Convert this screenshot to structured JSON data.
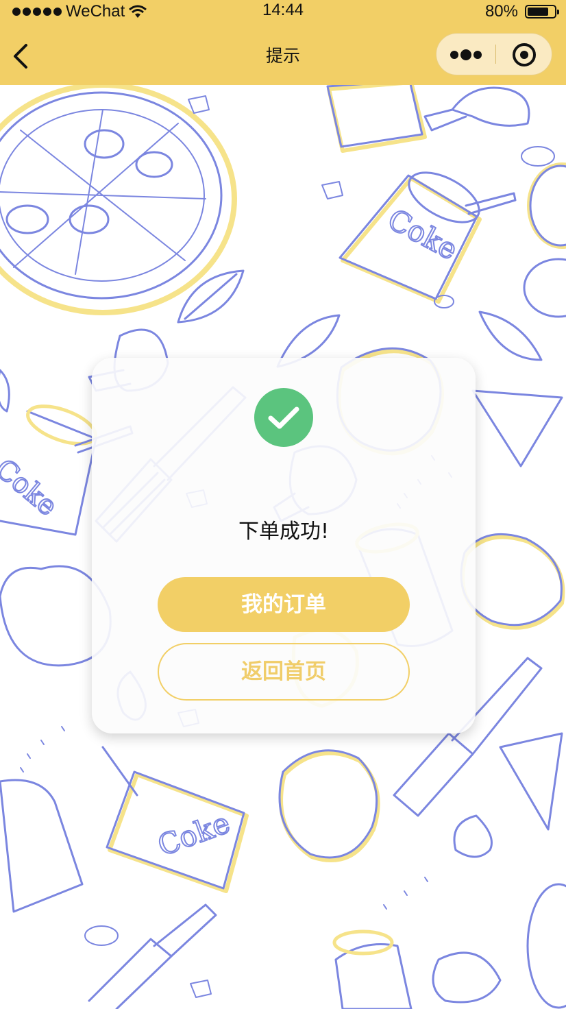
{
  "status_bar": {
    "carrier": "WeChat",
    "time": "14:44",
    "battery_percent_text": "80%",
    "battery_level": 0.8,
    "icons": [
      "signal-dots-icon",
      "wifi-icon",
      "battery-icon"
    ]
  },
  "nav_bar": {
    "title": "提示",
    "back_icon": "chevron-left-icon",
    "capsule_icons": [
      "more-dots-icon",
      "close-target-icon"
    ]
  },
  "dialog": {
    "icon": "check-circle-icon",
    "message": "下单成功!",
    "primary_button": "我的订单",
    "secondary_button": "返回首页"
  },
  "background": {
    "type": "food doodle pattern",
    "text": [
      "Coke"
    ]
  },
  "colors": {
    "accent": "#f2cf66",
    "success": "#5bc47e",
    "line_blue": "#7b86e0",
    "line_yellow": "#f6e38a"
  }
}
